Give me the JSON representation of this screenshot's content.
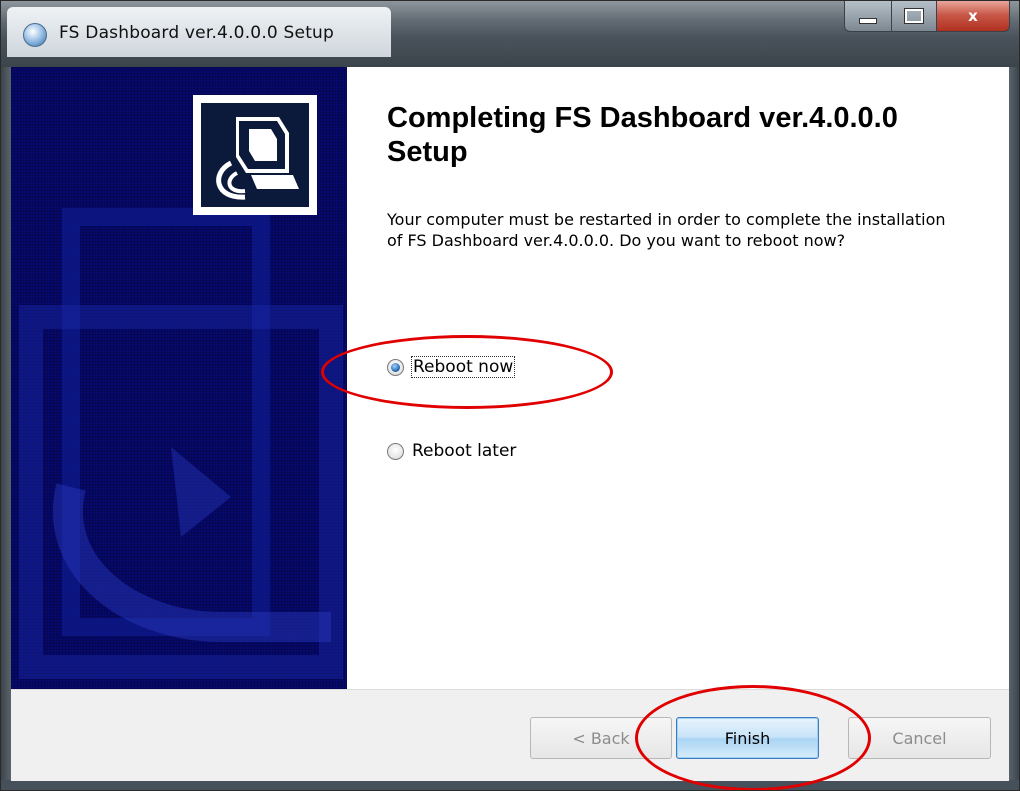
{
  "window": {
    "title": "FS Dashboard ver.4.0.0.0 Setup",
    "caption_close": "x"
  },
  "content": {
    "heading": "Completing FS Dashboard ver.4.0.0.0 Setup",
    "message": "Your computer must be restarted in order to complete the installation of FS Dashboard ver.4.0.0.0. Do you want to reboot now?",
    "options": [
      {
        "label": "Reboot now",
        "checked": true
      },
      {
        "label": "Reboot later",
        "checked": false
      }
    ]
  },
  "buttons": {
    "back": "< Back",
    "finish": "Finish",
    "cancel": "Cancel"
  },
  "colors": {
    "sidebar": "#06086c",
    "annotation": "#e00000",
    "finish_border": "#3b7bbf"
  },
  "icons": {
    "app": "setup-globe-icon",
    "sidebar_logo": "installer-computer-icon"
  }
}
